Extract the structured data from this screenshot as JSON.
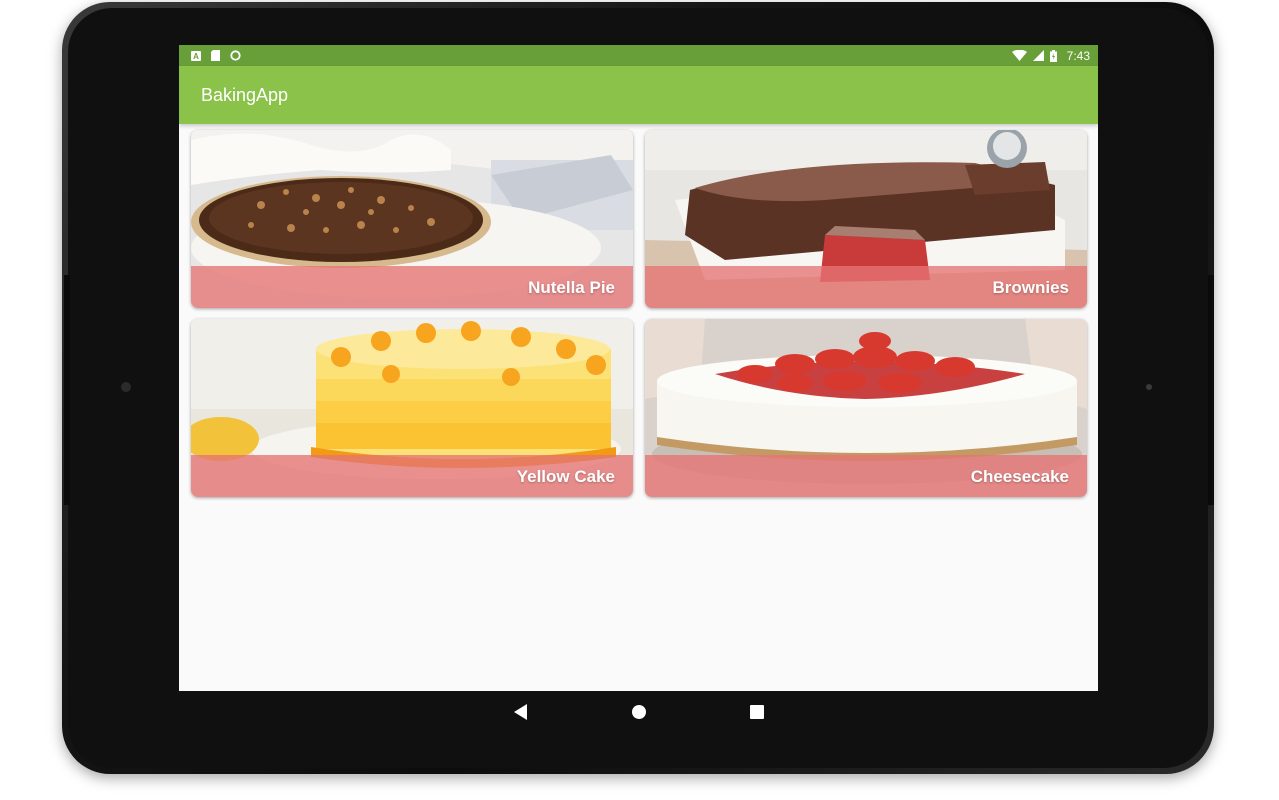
{
  "status_bar": {
    "time": "7:43",
    "left_icons": [
      "a-notification-icon",
      "sd-card-icon",
      "sync-icon"
    ],
    "right_icons": [
      "wifi-icon",
      "cell-signal-icon",
      "battery-icon"
    ]
  },
  "app_bar": {
    "title": "BakingApp"
  },
  "recipes": [
    {
      "name": "Nutella Pie"
    },
    {
      "name": "Brownies"
    },
    {
      "name": "Yellow Cake"
    },
    {
      "name": "Cheesecake"
    }
  ],
  "nav_bar": {
    "buttons": [
      "back-icon",
      "home-icon",
      "recents-icon"
    ]
  },
  "colors": {
    "status_bar": "#689f38",
    "app_bar": "#8bc34a",
    "card_label_overlay": "#e57373"
  }
}
